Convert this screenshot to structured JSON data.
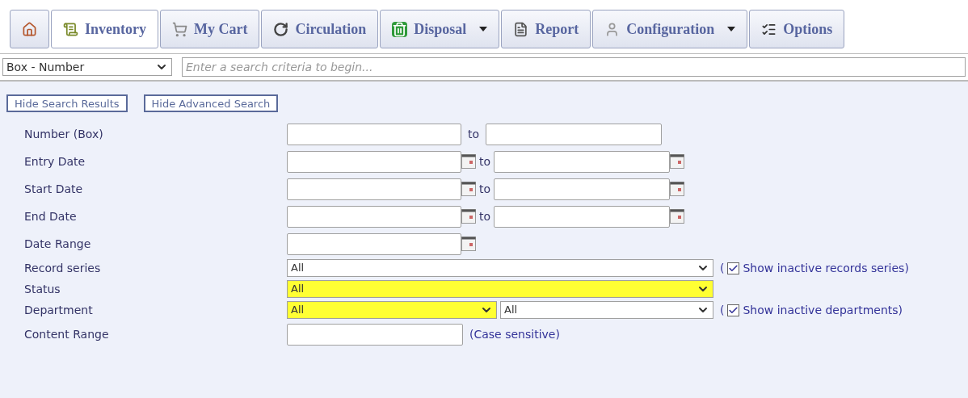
{
  "toolbar": {
    "tabs": [
      {
        "selected": false,
        "dropdown": false
      },
      {
        "label": "Inventory",
        "selected": true,
        "dropdown": false
      },
      {
        "label": "My Cart",
        "selected": false,
        "dropdown": false
      },
      {
        "label": "Circulation",
        "selected": false,
        "dropdown": false
      },
      {
        "label": "Disposal",
        "selected": false,
        "dropdown": true
      },
      {
        "label": "Report",
        "selected": false,
        "dropdown": false
      },
      {
        "label": "Configuration",
        "selected": false,
        "dropdown": true
      },
      {
        "label": "Options",
        "selected": false,
        "dropdown": false
      }
    ]
  },
  "search": {
    "field_select": "Box - Number",
    "placeholder": "Enter a search criteria to begin..."
  },
  "buttons": [
    "Hide Search Results",
    "Hide Advanced Search"
  ],
  "fields": [
    {
      "kind": "range",
      "label": "Number (Box)",
      "separator": "to"
    },
    {
      "kind": "date_range",
      "label": "Entry Date",
      "separator": "to"
    },
    {
      "kind": "date_range",
      "label": "Start Date",
      "separator": "to"
    },
    {
      "kind": "date_range",
      "label": "End Date",
      "separator": "to"
    },
    {
      "kind": "date",
      "label": "Date Range"
    },
    {
      "kind": "select",
      "label": "Record series",
      "selects": [
        {
          "value": "All",
          "highlighted": false
        }
      ],
      "option": {
        "open": "(",
        "label": "Show inactive records series",
        "close": ")",
        "checked": true
      }
    },
    {
      "kind": "select",
      "label": "Status",
      "selects": [
        {
          "value": "All",
          "highlighted": true
        }
      ]
    },
    {
      "kind": "select",
      "label": "Department",
      "selects": [
        {
          "value": "All",
          "highlighted": true
        },
        {
          "value": "All",
          "highlighted": false
        }
      ],
      "option": {
        "open": "(",
        "label": "Show inactive departments",
        "close": ")",
        "checked": true
      }
    },
    {
      "kind": "text",
      "label": "Content Range",
      "note": "(Case sensitive)"
    }
  ]
}
